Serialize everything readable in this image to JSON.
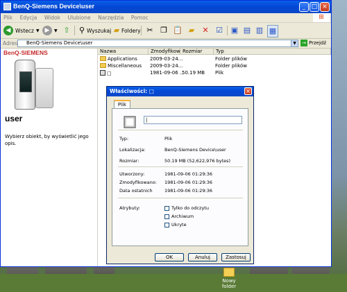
{
  "window": {
    "title": "BenQ-Siemens Device\\user",
    "menu": [
      "Plik",
      "Edycja",
      "Widok",
      "Ulubione",
      "Narzędzia",
      "Pomoc"
    ],
    "toolbar": {
      "back_label": "Wstecz",
      "search_label": "Wyszukaj",
      "folders_label": "Foldery"
    },
    "address": {
      "label": "Adres",
      "value": "BenQ-Siemens Device\\user",
      "go_label": "Przejdź"
    }
  },
  "left_panel": {
    "brand": "BenQ-SIEMENS",
    "folder_name": "user",
    "hint": "Wybierz obiekt, by wyświetlić jego opis."
  },
  "file_list": {
    "columns": [
      "Nazwa",
      "Zmodyfikowano",
      "Rozmiar",
      "Typ"
    ],
    "rows": [
      {
        "name": "Applications",
        "modified": "2009-03-24...",
        "size": "",
        "type": "Folder plików",
        "icon": "folder-icon"
      },
      {
        "name": "Miscellaneous",
        "modified": "2009-03-24...",
        "size": "",
        "type": "Folder plików",
        "icon": "folder-icon"
      },
      {
        "name": "□",
        "modified": "1981-09-06 ...",
        "size": "50.19 MB",
        "type": "Plik",
        "icon": "file-icon"
      }
    ]
  },
  "dialog": {
    "title": "Właściwości: □",
    "tab": "Plik",
    "name_value": "|",
    "props": [
      {
        "label": "Typ:",
        "value": "Plik"
      },
      {
        "label": "Lokalizacja:",
        "value": "BenQ-Siemens Device\\user"
      },
      {
        "label": "Rozmiar:",
        "value": "50.19 MB (52,622,976 bytes)"
      },
      {
        "label": "Utworzony:",
        "value": "1981-09-06 01:29:36"
      },
      {
        "label": "Zmodyfikowano:",
        "value": "1981-09-06 01:29:36"
      },
      {
        "label": "Data ostatnich",
        "value": "1981-09-06 01:29:36"
      }
    ],
    "attributes_label": "Atrybuty:",
    "attributes": [
      "Tylko do odczytu",
      "Archiwum",
      "Ukryte"
    ],
    "buttons": {
      "ok": "OK",
      "cancel": "Anuluj",
      "apply": "Zastosuj"
    }
  },
  "desktop": {
    "icon_label": "Nowy folder"
  }
}
